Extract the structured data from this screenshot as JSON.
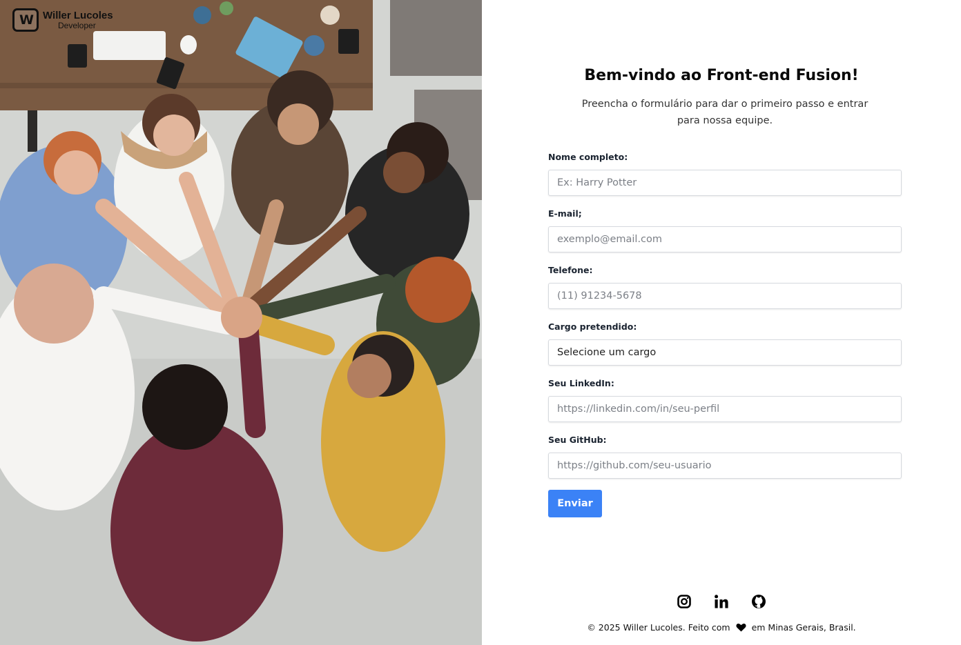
{
  "brand": {
    "name": "Willer Lucoles",
    "role": "Developer"
  },
  "page": {
    "title": "Bem-vindo ao Front-end Fusion!",
    "subtitle": "Preencha o formulário para dar o primeiro passo e entrar para nossa equipe."
  },
  "form": {
    "name_label": "Nome completo:",
    "name_placeholder": "Ex: Harry Potter",
    "email_label": "E-mail;",
    "email_placeholder": "exemplo@email.com",
    "phone_label": "Telefone:",
    "phone_placeholder": "(11) 91234-5678",
    "role_label": "Cargo pretendido:",
    "role_selected": "Selecione um cargo",
    "linkedin_label": "Seu LinkedIn:",
    "linkedin_placeholder": "https://linkedin.com/in/seu-perfil",
    "github_label": "Seu GitHub:",
    "github_placeholder": "https://github.com/seu-usuario",
    "submit_label": "Enviar"
  },
  "social": [
    "instagram-icon",
    "linkedin-icon",
    "github-icon"
  ],
  "footer": {
    "before": "© 2025 Willer Lucoles. Feito com",
    "after": "em Minas Gerais, Brasil."
  },
  "colors": {
    "accent": "#3b82f6",
    "text": "#111111",
    "input_border": "#d6d9de"
  }
}
